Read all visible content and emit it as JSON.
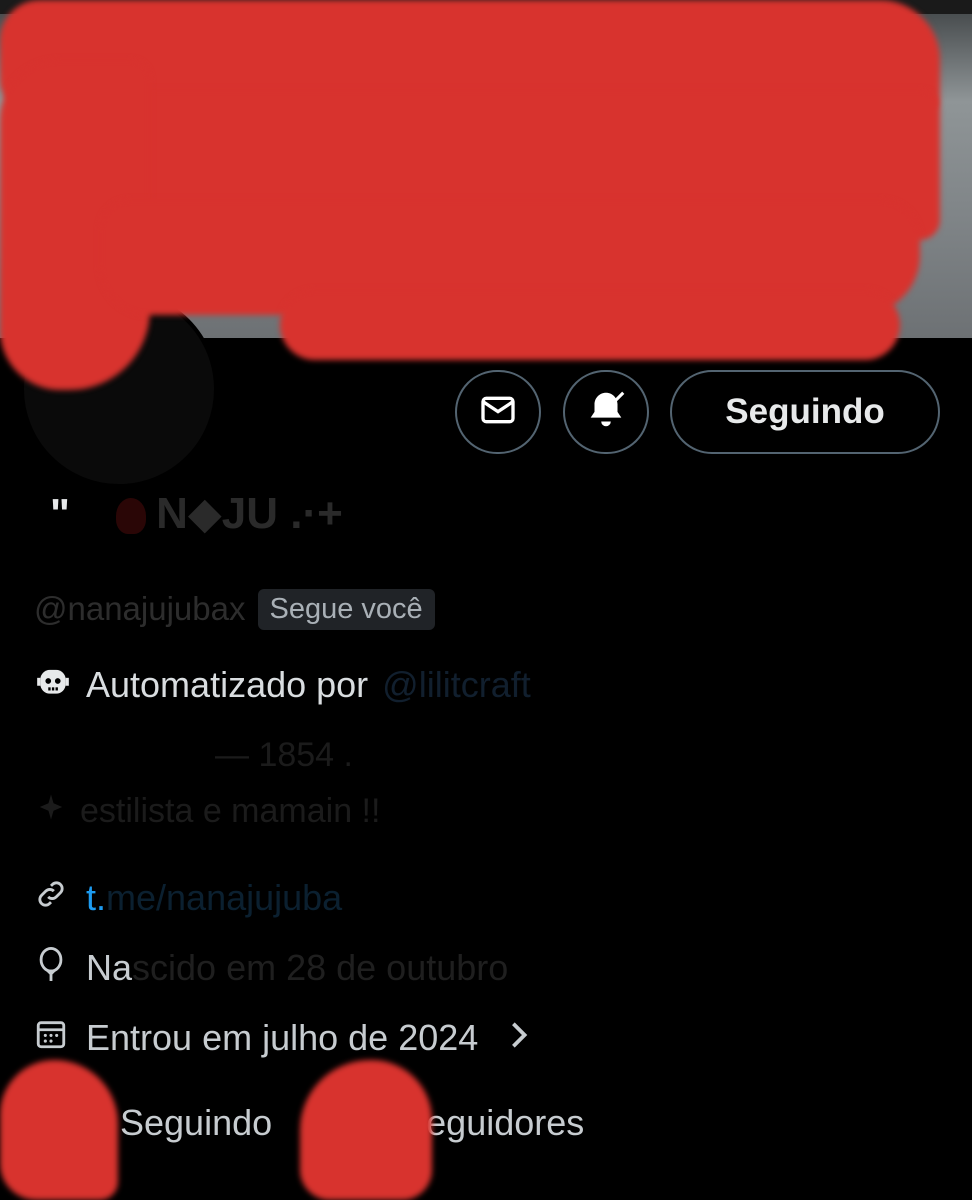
{
  "header": {
    "back_icon": "back-arrow-icon",
    "grok_icon": "grok-icon",
    "search_icon": "search-icon",
    "more_icon": "more-vertical-icon"
  },
  "profile_actions": {
    "message_icon": "mail-icon",
    "notify_icon": "bell-check-icon",
    "following_label": "Seguindo"
  },
  "profile": {
    "name_prefix": "\"",
    "display_name": "N◆JU .·+",
    "handle": "@nanajujubax",
    "follows_you_badge": "Segue você",
    "automated_label": "Automatizado por",
    "automated_handle": "@lilitcraft",
    "bio_line1": "— 1854 .",
    "bio_line2": "estilista e mamain !!",
    "link_start": "t.",
    "link_rest": "me/nanajujuba",
    "birthday_start": "Na",
    "birthday_rest": "scido em 28 de outubro",
    "joined": "Entrou em julho de 2024"
  },
  "stats": {
    "following_label": "Seguindo",
    "followers_label": "Seguidores"
  },
  "colors": {
    "background": "#000000",
    "accent_link": "#1d9bf0",
    "redaction": "#d8332e",
    "button_border": "#536471"
  }
}
